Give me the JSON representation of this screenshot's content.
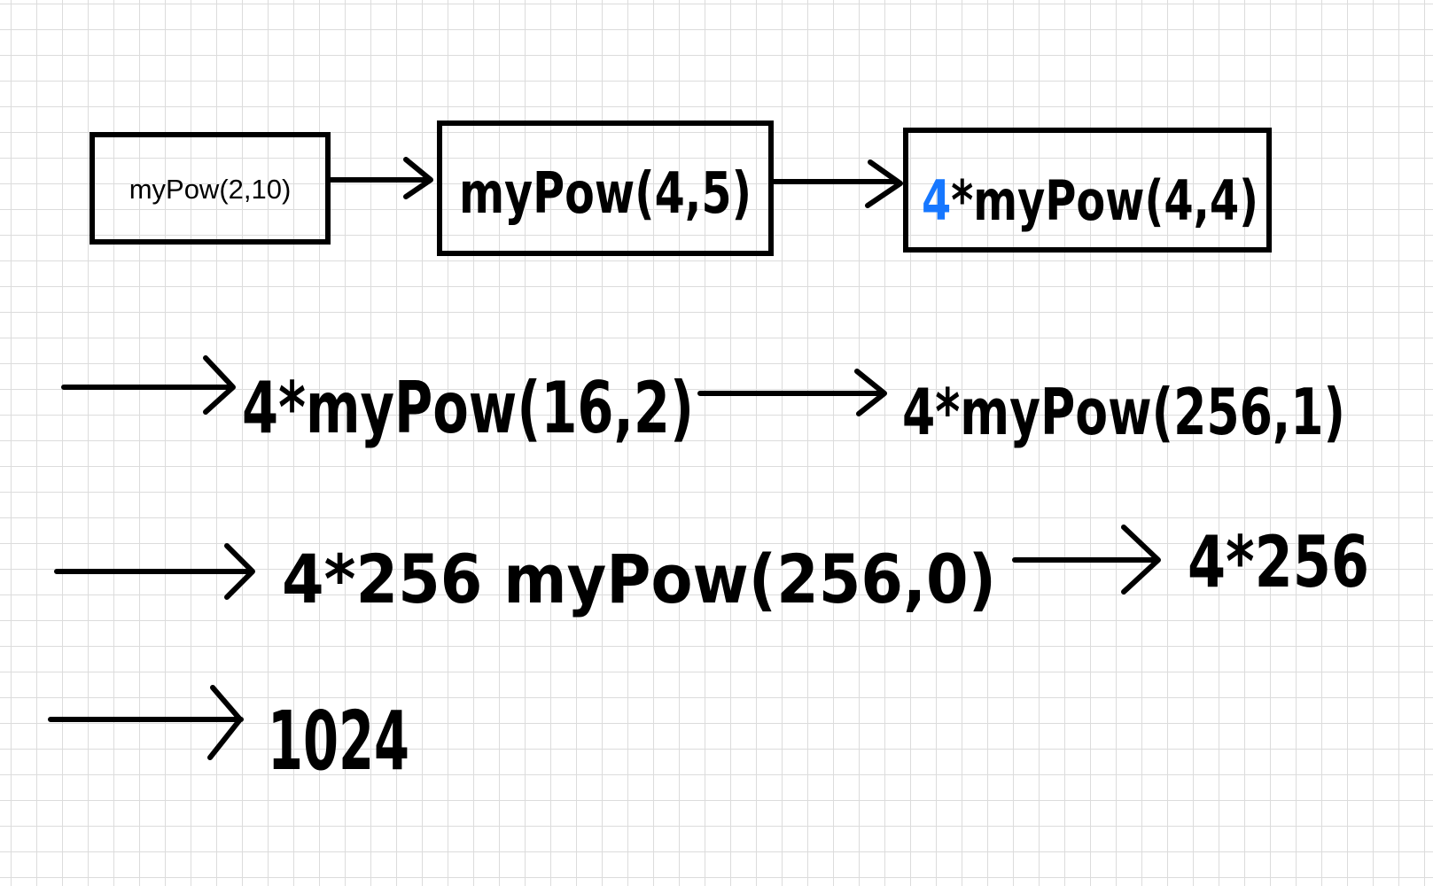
{
  "nodes": {
    "call_initial": "myPow(2,10)",
    "call_squared": "myPow(4,5)",
    "step1_coef": "4",
    "step1_rest": "*myPow(4,4)",
    "step2": "4*myPow(16,2)",
    "step3": "4*myPow(256,1)",
    "step4": "4*256 myPow(256,0)",
    "step5": "4*256",
    "result": "1024"
  },
  "colors": {
    "ink": "#000000",
    "highlight": "#1677ff",
    "grid": "#dcdcdc"
  }
}
